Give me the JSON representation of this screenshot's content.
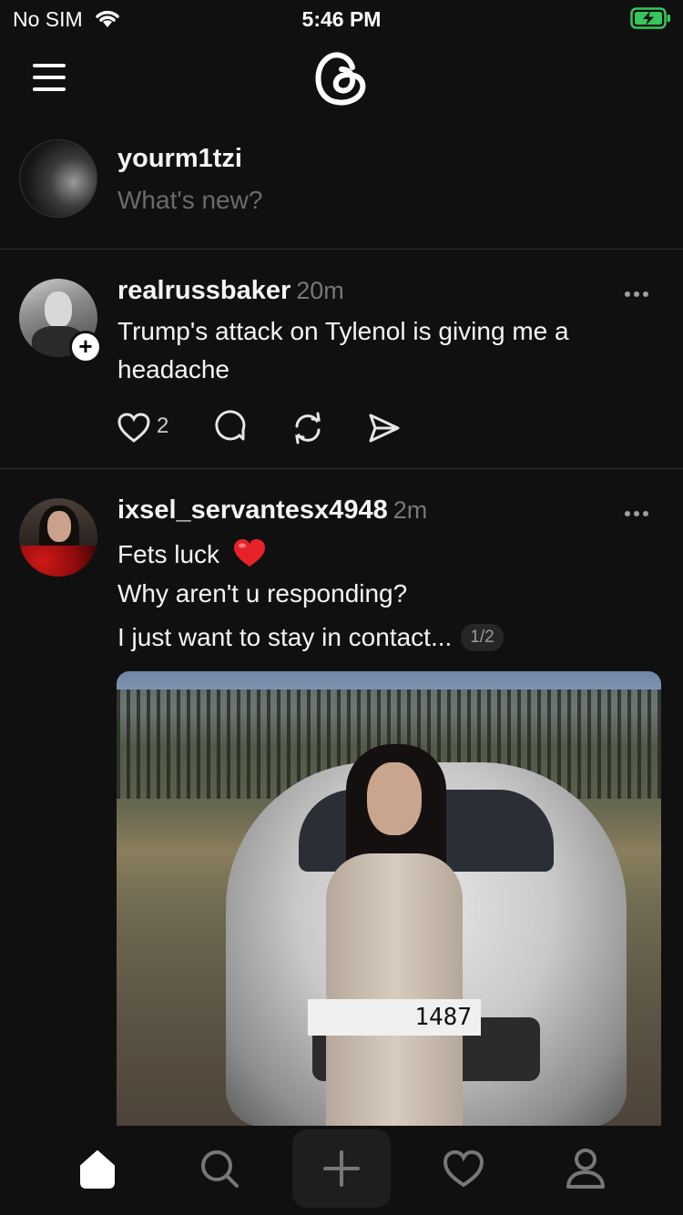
{
  "status_bar": {
    "carrier": "No SIM",
    "time": "5:46 PM",
    "battery_color": "#35c759"
  },
  "header": {
    "menu_icon": "hamburger-menu-icon",
    "logo_icon": "threads-logo-icon"
  },
  "composer": {
    "username": "yourm1tzi",
    "placeholder": "What's new?"
  },
  "posts": [
    {
      "username": "realrussbaker",
      "time": "20m",
      "text": "Trump's attack on Tylenol is giving me a headache",
      "likes": "2"
    },
    {
      "username": "ixsel_servantesx4948",
      "time": "2m",
      "line1": "Fets luck",
      "line2": "Why aren't u responding?",
      "line3": "I just want to stay in contact...",
      "page": "1/2",
      "plate_text": "1487"
    }
  ],
  "tab_bar": {
    "items": [
      "home-icon",
      "search-icon",
      "new-thread-icon",
      "activity-heart-icon",
      "profile-icon"
    ]
  },
  "colors": {
    "background": "#101010",
    "text": "#f3f5f7",
    "muted": "#6b6b6b",
    "divider": "#2e2e2e"
  }
}
